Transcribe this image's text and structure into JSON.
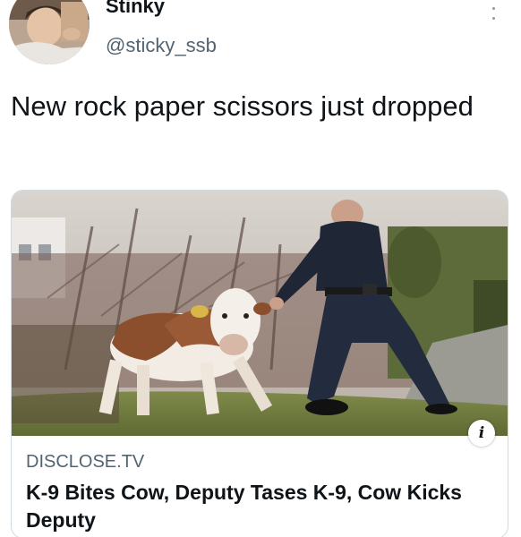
{
  "author": {
    "display_name": "Stinky",
    "handle": "@sticky_ssb",
    "avatar_icon": "profile-photo"
  },
  "tweet": {
    "text": "New rock paper scissors just dropped"
  },
  "link_card": {
    "image_description_icon": "news-photo",
    "source": "DISCLOSE.TV",
    "title": "K-9 Bites Cow, Deputy Tases K-9, Cow Kicks Deputy",
    "info_icon_glyph": "i"
  },
  "colors": {
    "text_primary": "#0f1419",
    "text_secondary": "#536471",
    "card_border": "#cfd9de"
  }
}
